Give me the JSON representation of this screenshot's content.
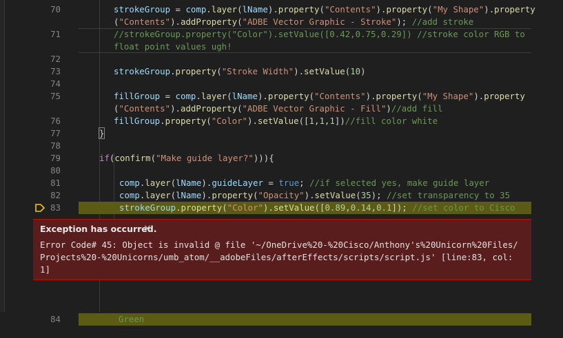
{
  "lines": [
    {
      "num": "70",
      "tokens": [
        [
          "v",
          "strokeGroup"
        ],
        [
          "p",
          " = "
        ],
        [
          "v",
          "comp"
        ],
        [
          "p",
          "."
        ],
        [
          "f",
          "layer"
        ],
        [
          "p",
          "("
        ],
        [
          "v",
          "lName"
        ],
        [
          "p",
          ")."
        ],
        [
          "f",
          "property"
        ],
        [
          "p",
          "("
        ],
        [
          "s",
          "\"Contents\""
        ],
        [
          "p",
          ")."
        ],
        [
          "f",
          "property"
        ],
        [
          "p",
          "("
        ],
        [
          "s",
          "\"My Shape\""
        ],
        [
          "p",
          ")."
        ],
        [
          "f",
          "property"
        ]
      ],
      "indent": 50
    },
    {
      "num": "",
      "tokens": [
        [
          "p",
          "("
        ],
        [
          "s",
          "\"Contents\""
        ],
        [
          "p",
          ")."
        ],
        [
          "f",
          "addProperty"
        ],
        [
          "p",
          "("
        ],
        [
          "s",
          "\"ADBE Vector Graphic - Stroke\""
        ],
        [
          "p",
          "); "
        ],
        [
          "c",
          "//add stroke"
        ]
      ],
      "indent": 50
    },
    {
      "num": "71",
      "tokens": [
        [
          "c",
          "//strokeGroup.property(\"Color\").setValue([0.42,0.75,0.29]) //stroke color RGB to"
        ]
      ],
      "indent": 50
    },
    {
      "num": "",
      "tokens": [
        [
          "c",
          "float point values ugh!"
        ]
      ],
      "indent": 50
    },
    {
      "num": "72",
      "tokens": [],
      "indent": 50
    },
    {
      "num": "73",
      "tokens": [
        [
          "v",
          "strokeGroup"
        ],
        [
          "p",
          "."
        ],
        [
          "f",
          "property"
        ],
        [
          "p",
          "("
        ],
        [
          "s",
          "\"Stroke Width\""
        ],
        [
          "p",
          ")."
        ],
        [
          "f",
          "setValue"
        ],
        [
          "p",
          "("
        ],
        [
          "n",
          "10"
        ],
        [
          "p",
          ")"
        ]
      ],
      "indent": 50
    },
    {
      "num": "74",
      "tokens": [],
      "indent": 50
    },
    {
      "num": "75",
      "tokens": [
        [
          "v",
          "fillGroup"
        ],
        [
          "p",
          " = "
        ],
        [
          "v",
          "comp"
        ],
        [
          "p",
          "."
        ],
        [
          "f",
          "layer"
        ],
        [
          "p",
          "("
        ],
        [
          "v",
          "lName"
        ],
        [
          "p",
          ")."
        ],
        [
          "f",
          "property"
        ],
        [
          "p",
          "("
        ],
        [
          "s",
          "\"Contents\""
        ],
        [
          "p",
          ")."
        ],
        [
          "f",
          "property"
        ],
        [
          "p",
          "("
        ],
        [
          "s",
          "\"My Shape\""
        ],
        [
          "p",
          ")."
        ],
        [
          "f",
          "property"
        ]
      ],
      "indent": 50
    },
    {
      "num": "",
      "tokens": [
        [
          "p",
          "("
        ],
        [
          "s",
          "\"Contents\""
        ],
        [
          "p",
          ")."
        ],
        [
          "f",
          "addProperty"
        ],
        [
          "p",
          "("
        ],
        [
          "s",
          "\"ADBE Vector Graphic - Fill\""
        ],
        [
          "p",
          ")"
        ],
        [
          "c",
          "//add fill"
        ]
      ],
      "indent": 50
    },
    {
      "num": "76",
      "tokens": [
        [
          "v",
          "fillGroup"
        ],
        [
          "p",
          "."
        ],
        [
          "f",
          "property"
        ],
        [
          "p",
          "("
        ],
        [
          "s",
          "\"Color\""
        ],
        [
          "p",
          ")."
        ],
        [
          "f",
          "setValue"
        ],
        [
          "p",
          "(["
        ],
        [
          "n",
          "1"
        ],
        [
          "p",
          ","
        ],
        [
          "n",
          "1"
        ],
        [
          "p",
          ","
        ],
        [
          "n",
          "1"
        ],
        [
          "p",
          "])"
        ],
        [
          "c",
          "//fill color white"
        ]
      ],
      "indent": 50
    },
    {
      "num": "77",
      "tokens": [
        [
          "brkt",
          "}"
        ]
      ],
      "indent": 29
    },
    {
      "num": "78",
      "tokens": [],
      "indent": 29
    },
    {
      "num": "79",
      "tokens": [
        [
          "k",
          "if"
        ],
        [
          "p",
          "("
        ],
        [
          "f",
          "confirm"
        ],
        [
          "p",
          "("
        ],
        [
          "s",
          "\"Make guide layer?\""
        ],
        [
          "p",
          "))){"
        ]
      ],
      "indent": 29
    },
    {
      "num": "80",
      "tokens": [],
      "indent": 29
    },
    {
      "num": "81",
      "tokens": [
        [
          "v",
          "comp"
        ],
        [
          "p",
          "."
        ],
        [
          "f",
          "layer"
        ],
        [
          "p",
          "("
        ],
        [
          "v",
          "lName"
        ],
        [
          "p",
          ")."
        ],
        [
          "v",
          "guideLayer"
        ],
        [
          "p",
          " = "
        ],
        [
          "b",
          "true"
        ],
        [
          "p",
          "; "
        ],
        [
          "c",
          "//if selected yes, make guide layer"
        ]
      ],
      "indent": 58
    },
    {
      "num": "82",
      "tokens": [
        [
          "v",
          "comp"
        ],
        [
          "p",
          "."
        ],
        [
          "f",
          "layer"
        ],
        [
          "p",
          "("
        ],
        [
          "v",
          "lName"
        ],
        [
          "p",
          ")."
        ],
        [
          "f",
          "property"
        ],
        [
          "p",
          "("
        ],
        [
          "s",
          "\"Opacity\""
        ],
        [
          "p",
          ")."
        ],
        [
          "f",
          "setValue"
        ],
        [
          "p",
          "("
        ],
        [
          "n",
          "35"
        ],
        [
          "p",
          "); "
        ],
        [
          "c",
          "//set transparency to 35"
        ]
      ],
      "indent": 58
    },
    {
      "num": "83",
      "tokens": [
        [
          "v",
          "strokeGroup"
        ],
        [
          "p",
          "."
        ],
        [
          "f",
          "property"
        ],
        [
          "p",
          "("
        ],
        [
          "s",
          "\"Color\""
        ],
        [
          "p",
          ")."
        ],
        [
          "f",
          "setValue"
        ],
        [
          "p",
          "(["
        ],
        [
          "n",
          "0.89"
        ],
        [
          "p",
          ","
        ],
        [
          "n",
          "0.14"
        ],
        [
          "p",
          ","
        ],
        [
          "n",
          "0.1"
        ],
        [
          "p",
          "]); "
        ],
        [
          "c",
          "//set color to Cisco"
        ]
      ],
      "indent": 58
    }
  ],
  "after_exception": {
    "continued_text": "Green",
    "next_line_num": "84"
  },
  "exception": {
    "title": "Exception has occurred.",
    "close_glyph": "×",
    "message": "Error Code# 45: Object is invalid @ file '~/OneDrive%20-%20Cisco/Anthony's%20Unicorn%20Files/Projects%20-%20Unicorns/umb_atom/__adobeFiles/afterEffects/scripts/script.js' [line:83, col:1]"
  },
  "colors": {
    "background": "#1f1f1f",
    "highlight_line": "#5b5b13",
    "exception_bg": "#5a1d1d",
    "exception_border": "#be1100",
    "debug_arrow": "#f5c518"
  }
}
